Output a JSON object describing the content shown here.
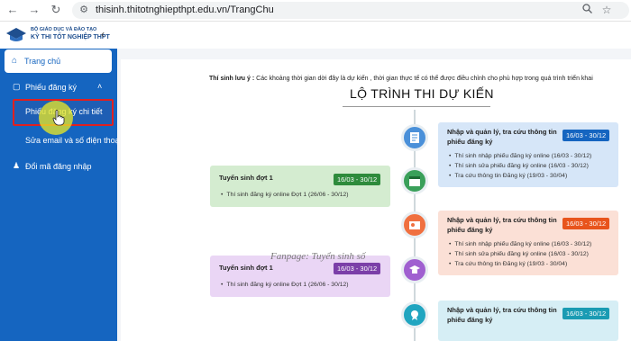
{
  "browser": {
    "back_icon": "←",
    "forward_icon": "→",
    "reload_icon": "↻",
    "url_icon": "⚙",
    "url": "thisinh.thitotnghiepthpt.edu.vn/TrangChu",
    "star_icon": "☆",
    "zoom_icon": "🔍"
  },
  "header": {
    "logo_line1": "BỘ GIÁO DỤC VÀ ĐÀO TẠO",
    "logo_line2": "KỲ THI TỐT NGHIỆP THPT",
    "collapse_icon": "‹"
  },
  "sidebar": {
    "home": {
      "icon": "⌂",
      "label": "Trang chủ"
    },
    "registration": {
      "icon": "▢",
      "label": "Phiếu đăng ký",
      "chevron": "˄"
    },
    "registration_detail": {
      "label": "Phiếu đăng ký chi tiết"
    },
    "edit_contact": {
      "label": "Sửa email và số điện thoại"
    },
    "change_password": {
      "icon": "♟",
      "label": "Đổi mã đăng nhập"
    }
  },
  "main": {
    "notice_bold": "Thí sinh lưu ý :",
    "notice_text": " Các khoảng thời gian dời đây là dự kiến , thời gian thực tế có thể được điều chỉnh cho phù hợp trong quá trình triển khai",
    "timeline_title": "LỘ TRÌNH THI DỰ KIẾN",
    "watermark": "Fanpage: Tuyển sinh số"
  },
  "cards": {
    "right1": {
      "title_line1": "Nhập và quản lý, tra cứu thông tin",
      "title_line2": "phiếu đăng ký",
      "badge": "16/03 - 30/12",
      "items": [
        "Thí sinh nhập phiếu đăng ký online (16/03 - 30/12)",
        "Thí sinh sửa phiếu đăng ký online (16/03 - 30/12)",
        "Tra cứu thông tin Đăng ký (19/03 - 30/04)"
      ]
    },
    "left1": {
      "title": "Tuyển sinh đợt 1",
      "badge": "16/03 - 30/12",
      "items": [
        "Thí sinh đăng ký online Đợt 1 (26/06 - 30/12)"
      ]
    },
    "right2": {
      "title_line1": "Nhập và quản lý, tra cứu thông tin",
      "title_line2": "phiếu đăng ký",
      "badge": "16/03 - 30/12",
      "items": [
        "Thí sinh nhập phiếu đăng ký online (16/03 - 30/12)",
        "Thí sinh sửa phiếu đăng ký online (16/03 - 30/12)",
        "Tra cứu thông tin Đăng ký (19/03 - 30/04)"
      ]
    },
    "left2": {
      "title": "Tuyển sinh đợt 1",
      "badge": "16/03 - 30/12",
      "items": [
        "Thí sinh đăng ký online Đợt 1 (26/06 - 30/12)"
      ]
    },
    "right3": {
      "title_line1": "Nhập và quản lý, tra cứu thông tin",
      "title_line2": "phiếu đăng ký",
      "badge": "16/03 - 30/12"
    }
  },
  "colors": {
    "sidebar": "#1565c0",
    "blue_card": "#d6e6f8",
    "blue_badge": "#1565c0",
    "green_card": "#d4ecd0",
    "green_badge": "#2e8b3c",
    "orange_card": "#fbe0d6",
    "orange_badge": "#e8541c",
    "purple_card": "#ead6f5",
    "purple_badge": "#7b3fa8",
    "teal_card": "#d6eef5",
    "teal_badge": "#1a9bb3"
  }
}
